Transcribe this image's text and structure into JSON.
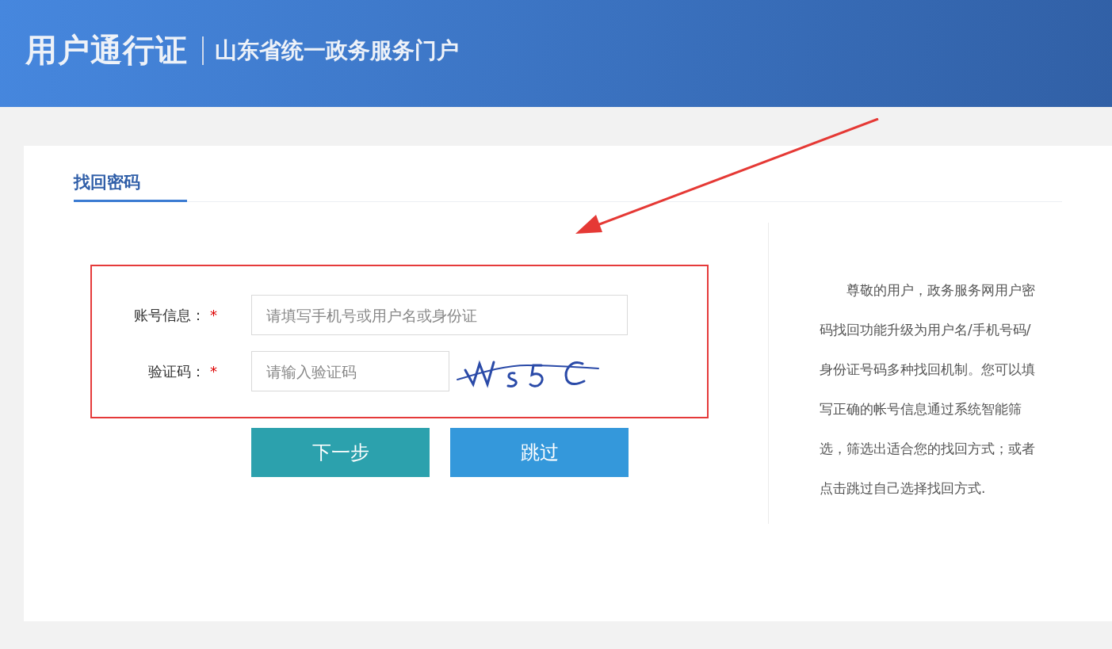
{
  "header": {
    "title": "用户通行证",
    "subtitle": "山东省统一政务服务门户"
  },
  "tab": {
    "label": "找回密码"
  },
  "fields": [
    {
      "label": "账号信息：",
      "required_mark": "*",
      "placeholder": "请填写手机号或用户名或身份证",
      "kind": "text"
    },
    {
      "label": "验证码：",
      "required_mark": "*",
      "placeholder": "请输入验证码",
      "kind": "captcha"
    }
  ],
  "buttons": [
    {
      "label": "下一步",
      "kind": "primary"
    },
    {
      "label": "跳过",
      "kind": "secondary"
    }
  ],
  "notice": "尊敬的用户，政务服务网用户密码找回功能升级为用户名/手机号码/身份证号码多种找回机制。您可以填写正确的帐号信息通过系统智能筛选，筛选出适合您的找回方式；或者点击跳过自己选择找回方式."
}
